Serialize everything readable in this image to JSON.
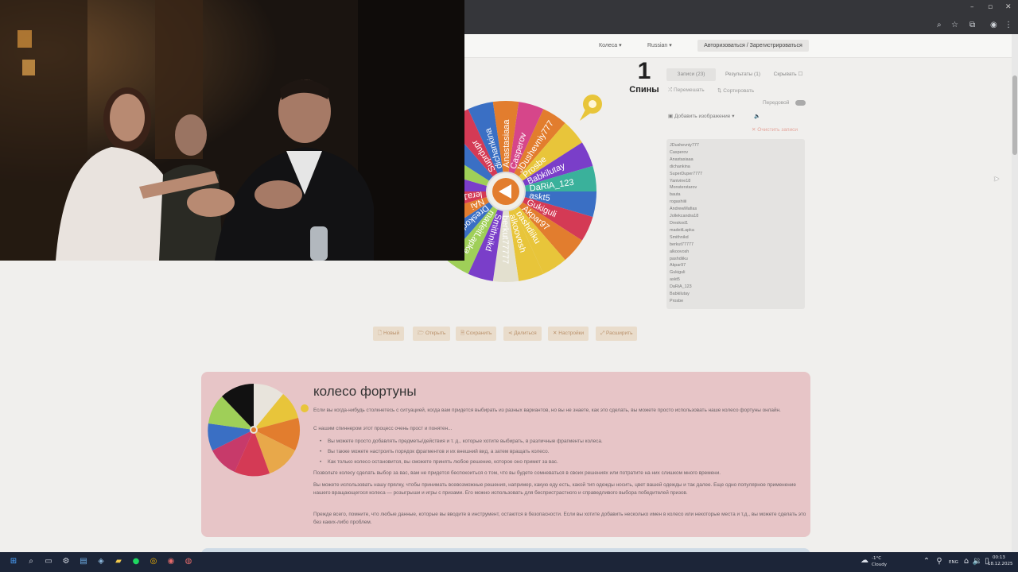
{
  "browser": {
    "window_controls": [
      "–",
      "▫",
      "✕"
    ]
  },
  "site": {
    "nav": {
      "wheels": "Колеса",
      "language": "Russian",
      "auth": "Авторизоваться / Зарегистрироваться"
    },
    "spins": {
      "count": "1",
      "label": "Спины"
    },
    "tabs": {
      "entries": "Записи (23)",
      "results": "Результаты (1)",
      "hide": "Скрывать"
    },
    "controls": {
      "shuffle": "Перемешать",
      "sort": "Сортировать",
      "advanced": "Передовой",
      "add_image": "Добавить изображение",
      "clear": "Очистить записи"
    },
    "names": [
      "JDushevniy777",
      "Casperov",
      "Anastasiaaa",
      "dichankina",
      "SuperDuper7777",
      "Yanivine18",
      "Monsterstarov",
      "bauta",
      "rogashiiii",
      "AndrewMafias",
      "Jollekcandra18",
      "Dreskod1",
      "madeitLapka",
      "Smithnikd",
      "berkut77777",
      "alkoovosh",
      "pashdiiku",
      "Akpar97",
      "Gukiguli",
      "askt5",
      "DaRiA_123",
      "Babkilutay",
      "Prosbe"
    ],
    "wheel_labels": [
      "Casperov",
      "JDushevniy777",
      "Prosbe",
      "Babkilutay",
      "DaRiA_123",
      "askt5",
      "Gukiguli",
      "Akpar97",
      "pashdiiku",
      "alkoovosh",
      "berkut77777",
      "Smithnikd",
      "madeitLapka",
      "Dreskod1",
      "NAi",
      "lera18",
      "",
      "",
      "",
      "Suprdupr",
      "dichankina",
      "Anastasiaaa"
    ],
    "wheel_colors": [
      "#d6468a",
      "#e27d2e",
      "#e8c53a",
      "#7a3ec9",
      "#3ab19b",
      "#3a6fc4",
      "#d43a55",
      "#e27d2e",
      "#e8c53a",
      "#e8c53a",
      "#e3e0cf",
      "#7a3ec9",
      "#9fcf58",
      "#3a6fc4",
      "#e27d2e",
      "#d43a55",
      "#7a3ec9",
      "#9fcf58",
      "#3a6fc4",
      "#d43a55",
      "#3a6fc4",
      "#e27d2e"
    ],
    "bottom_buttons": [
      "Новый",
      "Открыть",
      "Сохранить",
      "Делиться",
      "Настройки",
      "Расширить"
    ],
    "article": {
      "title": "колесо фортуны",
      "p1": "Если вы когда-нибудь столкнетесь с ситуацией, когда вам придется выбирать из разных вариантов, но вы не знаете, как это сделать, вы можете просто использовать наше колесо фортуны онлайн.",
      "p2": "С нашим спиннером этот процесс очень прост и понятен...",
      "bullets": [
        "Вы можете просто добавлять предметы/действия и т. д., которые хотите выбирать, в различные фрагменты колеса.",
        "Вы также можете настроить порядок фрагментов и их внешний вид, а затем вращать колесо.",
        "Как только колесо остановится, вы сможете принять любое решение, которое оно примет за вас."
      ],
      "p3": "Позвольте колесу сделать выбор за вас, вам не придется беспокоиться о том, что вы будете сомневаться в своих решениях или потратите на них слишком много времени.",
      "p4": "Вы можете использовать нашу прялку, чтобы принимать всевозможные решения, например, какую еду есть, какой тип одежды носить, цвет вашей одежды и так далее. Еще одно популярное применение нашего вращающегося колеса — розыгрыши и игры с призами. Его можно использовать для беспристрастного и справедливого выбора победителей призов.",
      "p5": "Прежде всего, помните, что любые данные, которые вы вводите в инструмент, остаются в безопасности. Если вы хотите добавить несколько имен в колесо или некоторые места и т.д., вы можете сделать это без каких-либо проблем."
    }
  },
  "taskbar": {
    "weather_temp": "-1°C",
    "weather_desc": "Cloudy",
    "lang": "ENG",
    "time": "00:13",
    "date": "18.12.2025"
  }
}
